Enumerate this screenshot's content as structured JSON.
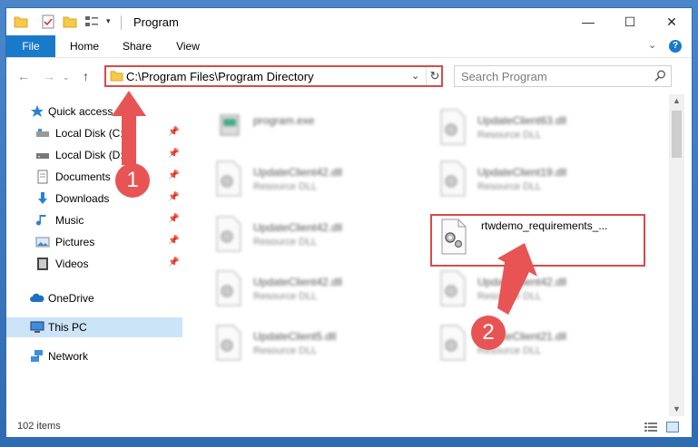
{
  "window": {
    "title": "Program",
    "min_label": "—",
    "max_label": "☐",
    "close_label": "✕"
  },
  "ribbon": {
    "tabs": [
      "File",
      "Home",
      "Share",
      "View"
    ],
    "help": "?"
  },
  "address": {
    "path": "C:\\Program Files\\Program Directory",
    "refresh": "↻"
  },
  "search": {
    "placeholder": "Search Program"
  },
  "sidebar": {
    "items": [
      {
        "label": "Quick access",
        "icon": "star-icon"
      },
      {
        "label": "Local Disk (C:)",
        "icon": "drive-icon",
        "pinned": true
      },
      {
        "label": "Local Disk (D:)",
        "icon": "drive-icon",
        "pinned": true
      },
      {
        "label": "Documents",
        "icon": "documents-icon",
        "pinned": true
      },
      {
        "label": "Downloads",
        "icon": "download-icon",
        "pinned": true
      },
      {
        "label": "Music",
        "icon": "music-icon",
        "pinned": true
      },
      {
        "label": "Pictures",
        "icon": "pictures-icon",
        "pinned": true
      },
      {
        "label": "Videos",
        "icon": "videos-icon",
        "pinned": true
      },
      {
        "label": "OneDrive",
        "icon": "cloud-icon"
      },
      {
        "label": "This PC",
        "icon": "computer-icon"
      },
      {
        "label": "Network",
        "icon": "network-icon"
      }
    ]
  },
  "files": [
    {
      "name": "program.exe",
      "type": ""
    },
    {
      "name": "UpdateClient63.dll",
      "type": "Resource DLL"
    },
    {
      "name": "UpdateClient42.dll",
      "type": "Resource DLL"
    },
    {
      "name": "UpdateClient19.dll",
      "type": "Resource DLL"
    },
    {
      "name": "UpdateClient42.dll",
      "type": "Resource DLL"
    },
    {
      "name": "rtwdemo_requirements_...",
      "type": ""
    },
    {
      "name": "UpdateClient42.dll",
      "type": "Resource DLL"
    },
    {
      "name": "UpdateClient42.dll",
      "type": "Resource DLL"
    },
    {
      "name": "UpdateClient5.dll",
      "type": "Resource DLL"
    },
    {
      "name": "UpdateClient21.dll",
      "type": "Resource DLL"
    }
  ],
  "status": {
    "items": "102 items"
  },
  "annotations": {
    "step1": "1",
    "step2": "2"
  },
  "colors": {
    "accent": "#1979ca",
    "highlight": "#d94a4a",
    "selected": "#cce4f7"
  }
}
